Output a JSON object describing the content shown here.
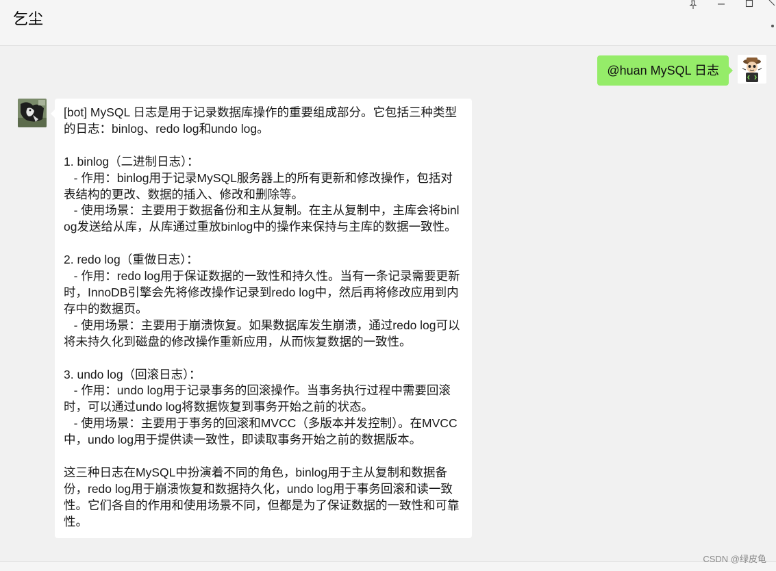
{
  "window": {
    "title": "乞尘",
    "controls": [
      "pin-icon",
      "minimize-icon",
      "maximize-icon",
      "close-icon"
    ]
  },
  "messages": [
    {
      "direction": "outgoing",
      "avatar": "cartoon-avatar",
      "text": "@huan MySQL 日志"
    },
    {
      "direction": "incoming",
      "avatar": "dog-photo-avatar",
      "text": "[bot] MySQL 日志是用于记录数据库操作的重要组成部分。它包括三种类型的日志：binlog、redo log和undo log。\n\n1. binlog（二进制日志）：\n   - 作用：binlog用于记录MySQL服务器上的所有更新和修改操作，包括对表结构的更改、数据的插入、修改和删除等。\n   - 使用场景：主要用于数据备份和主从复制。在主从复制中，主库会将binlog发送给从库，从库通过重放binlog中的操作来保持与主库的数据一致性。\n\n2. redo log（重做日志）：\n   - 作用：redo log用于保证数据的一致性和持久性。当有一条记录需要更新时，InnoDB引擎会先将修改操作记录到redo log中，然后再将修改应用到内存中的数据页。\n   - 使用场景：主要用于崩溃恢复。如果数据库发生崩溃，通过redo log可以将未持久化到磁盘的修改操作重新应用，从而恢复数据的一致性。\n\n3. undo log（回滚日志）：\n   - 作用：undo log用于记录事务的回滚操作。当事务执行过程中需要回滚时，可以通过undo log将数据恢复到事务开始之前的状态。\n   - 使用场景：主要用于事务的回滚和MVCC（多版本并发控制）。在MVCC中，undo log用于提供读一致性，即读取事务开始之前的数据版本。\n\n这三种日志在MySQL中扮演着不同的角色，binlog用于主从复制和数据备份，redo log用于崩溃恢复和数据持久化，undo log用于事务回滚和读一致性。它们各自的作用和使用场景不同，但都是为了保证数据的一致性和可靠性。"
    }
  ],
  "watermark": "CSDN @绿皮龟",
  "colors": {
    "outgoing_bubble": "#95ec69",
    "incoming_bubble": "#ffffff",
    "background": "#f1f1f1"
  }
}
